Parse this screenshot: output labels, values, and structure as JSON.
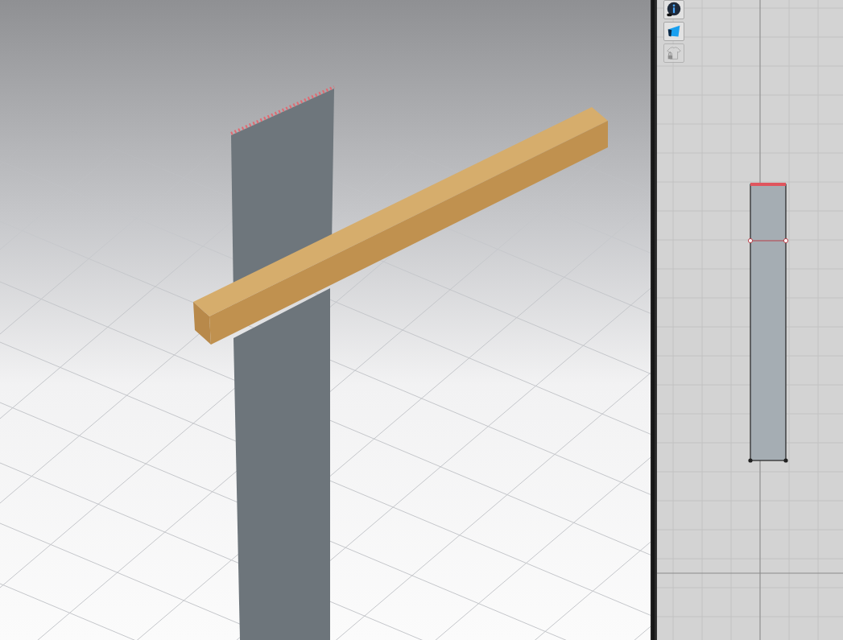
{
  "toolbar": [
    {
      "kind": "info",
      "disabled": false
    },
    {
      "kind": "fabric",
      "disabled": false
    },
    {
      "kind": "locked-garment",
      "disabled": true
    }
  ]
}
